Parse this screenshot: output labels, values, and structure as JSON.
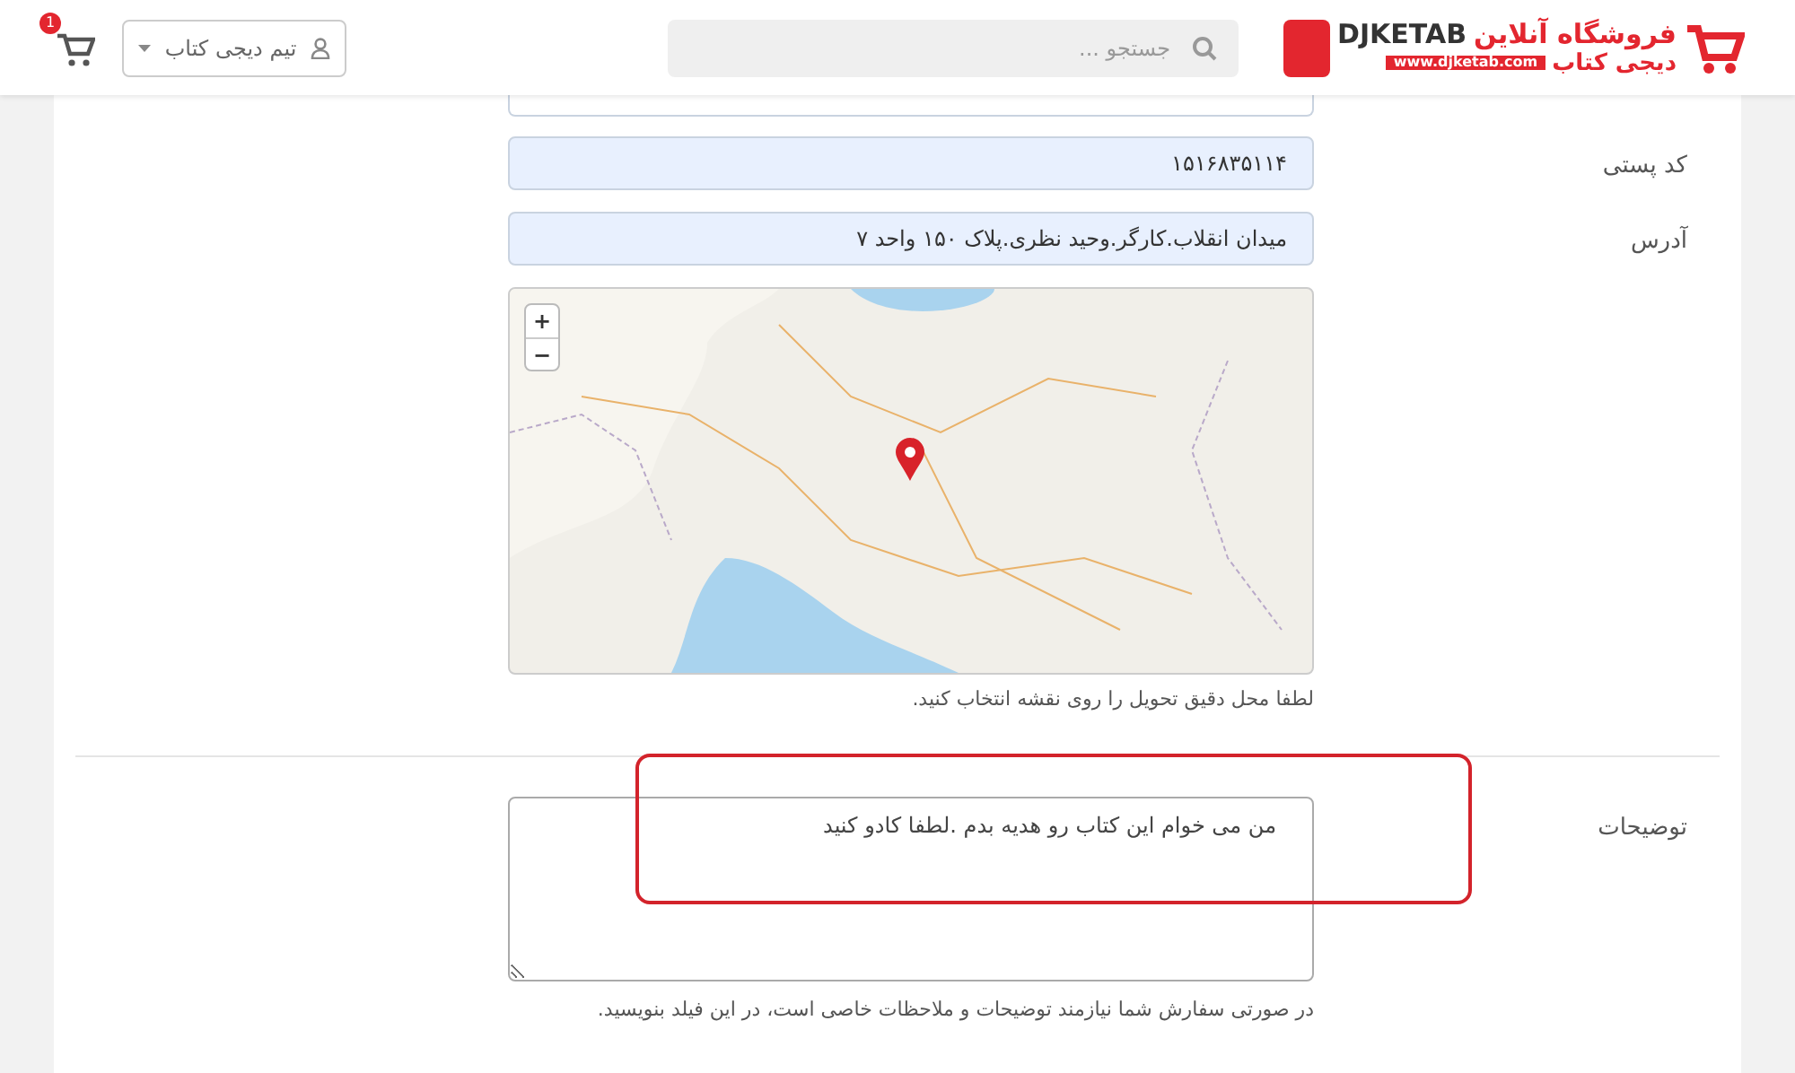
{
  "header": {
    "logo": {
      "tagline": "فروشگاه آنلاین",
      "brand": "DJKETAB",
      "brand_fa": "دیجی کتاب",
      "url": "www.djketab.com"
    },
    "search": {
      "placeholder": "جستجو ..."
    },
    "user_menu": {
      "label": "تیم دیجی کتاب"
    },
    "cart": {
      "count": "1"
    }
  },
  "form": {
    "fields": [
      {
        "kind": "input_cut"
      },
      {
        "kind": "input",
        "label": "کد پستی",
        "value": "۱۵۱۶۸۳۵۱۱۴"
      },
      {
        "kind": "input",
        "label": "آدرس",
        "value": "میدان انقلاب.کارگر.وحید نظری.پلاک ۱۵۰ واحد ۷"
      },
      {
        "kind": "map",
        "zoom_in": "+",
        "zoom_out": "−",
        "hint": "لطفا محل دقیق تحویل را روی نقشه انتخاب کنید."
      },
      {
        "kind": "textarea",
        "label": "توضیحات",
        "value": "من می خوام این کتاب رو هدیه بدم .لطفا کادو کنید",
        "hint": "در صورتی سفارش شما نیازمند توضیحات و ملاحظات خاصی است، در این فیلد بنویسید.",
        "highlighted": true
      }
    ]
  }
}
